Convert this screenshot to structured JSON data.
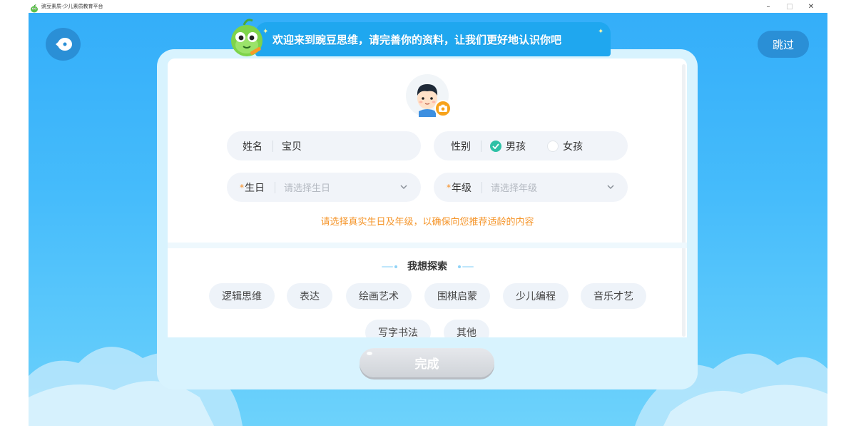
{
  "window": {
    "title": "豌豆素质-少儿素质教育平台",
    "controls": {
      "minimize": "–",
      "maximize": "□",
      "close": "✕"
    }
  },
  "header": {
    "back_icon": "back-arrow-icon",
    "skip_label": "跳过"
  },
  "banner": {
    "text": "欢迎来到豌豆思维，请完善你的资料，让我们更好地认识你吧"
  },
  "profile": {
    "name": {
      "label": "姓名",
      "value": "宝贝"
    },
    "gender": {
      "label": "性别",
      "options": [
        {
          "label": "男孩",
          "checked": true
        },
        {
          "label": "女孩",
          "checked": false
        }
      ]
    },
    "birthday": {
      "required_mark": "*",
      "label": "生日",
      "placeholder": "请选择生日"
    },
    "grade": {
      "required_mark": "*",
      "label": "年级",
      "placeholder": "请选择年级"
    },
    "hint": "请选择真实生日及年级，以确保向您推荐适龄的内容"
  },
  "explore": {
    "title": "我想探索",
    "interests": [
      "逻辑思维",
      "表达",
      "绘画艺术",
      "围棋启蒙",
      "少儿编程",
      "音乐才艺",
      "写字书法",
      "其他"
    ]
  },
  "footer": {
    "done_label": "完成"
  },
  "colors": {
    "background_top": "#34aef9",
    "banner": "#1fa7ef",
    "accent_orange": "#f5952a",
    "check_green": "#2ec1a6",
    "button_disabled": "#cfd3d8"
  }
}
